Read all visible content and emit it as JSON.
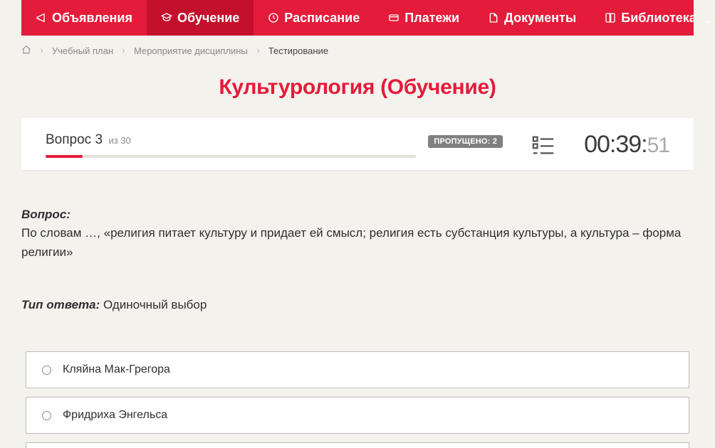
{
  "nav": {
    "items": [
      {
        "label": "Объявления",
        "icon": "megaphone-icon",
        "active": false
      },
      {
        "label": "Обучение",
        "icon": "cap-icon",
        "active": true
      },
      {
        "label": "Расписание",
        "icon": "clock-icon",
        "active": false
      },
      {
        "label": "Платежи",
        "icon": "card-icon",
        "active": false
      },
      {
        "label": "Документы",
        "icon": "file-icon",
        "active": false
      },
      {
        "label": "Библиотека",
        "icon": "book-icon",
        "active": false,
        "has_chevron": true
      }
    ]
  },
  "breadcrumb": {
    "items": [
      {
        "label": "Учебный план",
        "current": false
      },
      {
        "label": "Мероприятие дисциплины",
        "current": false
      },
      {
        "label": "Тестирование",
        "current": true
      }
    ]
  },
  "page_title": "Культурология (Обучение)",
  "progress": {
    "question_label": "Вопрос 3",
    "total_label": "из 30",
    "skipped_badge": "ПРОПУЩЕНО: 2",
    "percent": 10
  },
  "timer": {
    "mm": "00",
    "ss": "39",
    "cs": "51"
  },
  "question": {
    "label": "Вопрос:",
    "text": "По словам …, «религия питает культуру и придает ей смысл; религия есть субстанция культуры, а культура – форма религии»"
  },
  "answer_type": {
    "label": "Тип ответа:",
    "value": "Одиночный выбор"
  },
  "options": [
    {
      "text": "Кляйна Мак-Грегора"
    },
    {
      "text": "Фридриха Энгельса"
    }
  ]
}
